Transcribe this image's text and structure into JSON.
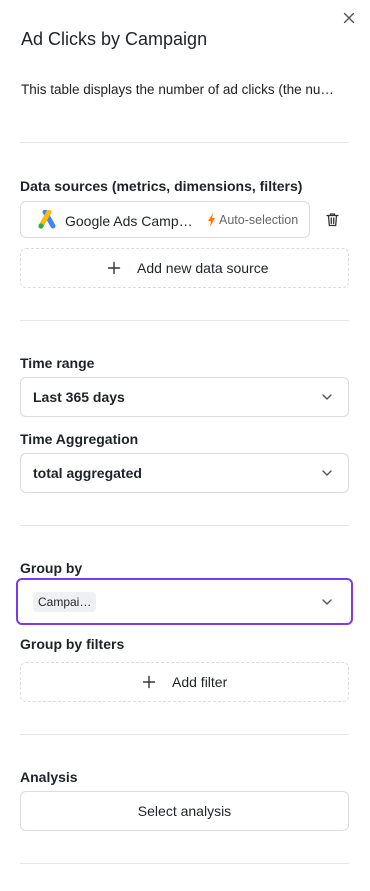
{
  "panel": {
    "title": "Ad Clicks by Campaign",
    "description": "This table displays the number of ad clicks (the nu…"
  },
  "data_sources": {
    "label": "Data sources (metrics, dimensions, filters)",
    "items": [
      {
        "name": "Google Ads Camp…",
        "icon": "google-ads-icon",
        "badge": "Auto-selection"
      }
    ],
    "add_label": "Add new data source"
  },
  "time_range": {
    "label": "Time range",
    "value": "Last 365 days"
  },
  "time_aggregation": {
    "label": "Time Aggregation",
    "value": "total aggregated"
  },
  "group_by": {
    "label": "Group by",
    "chip": "Campai…",
    "filters_label": "Group by filters",
    "add_filter_label": "Add filter"
  },
  "analysis": {
    "label": "Analysis",
    "button_label": "Select analysis"
  },
  "colors": {
    "accent": "#7c3aed",
    "bolt": "#f97316",
    "google_blue": "#4285F4",
    "google_yellow": "#FBBC04",
    "google_green": "#34A853"
  }
}
